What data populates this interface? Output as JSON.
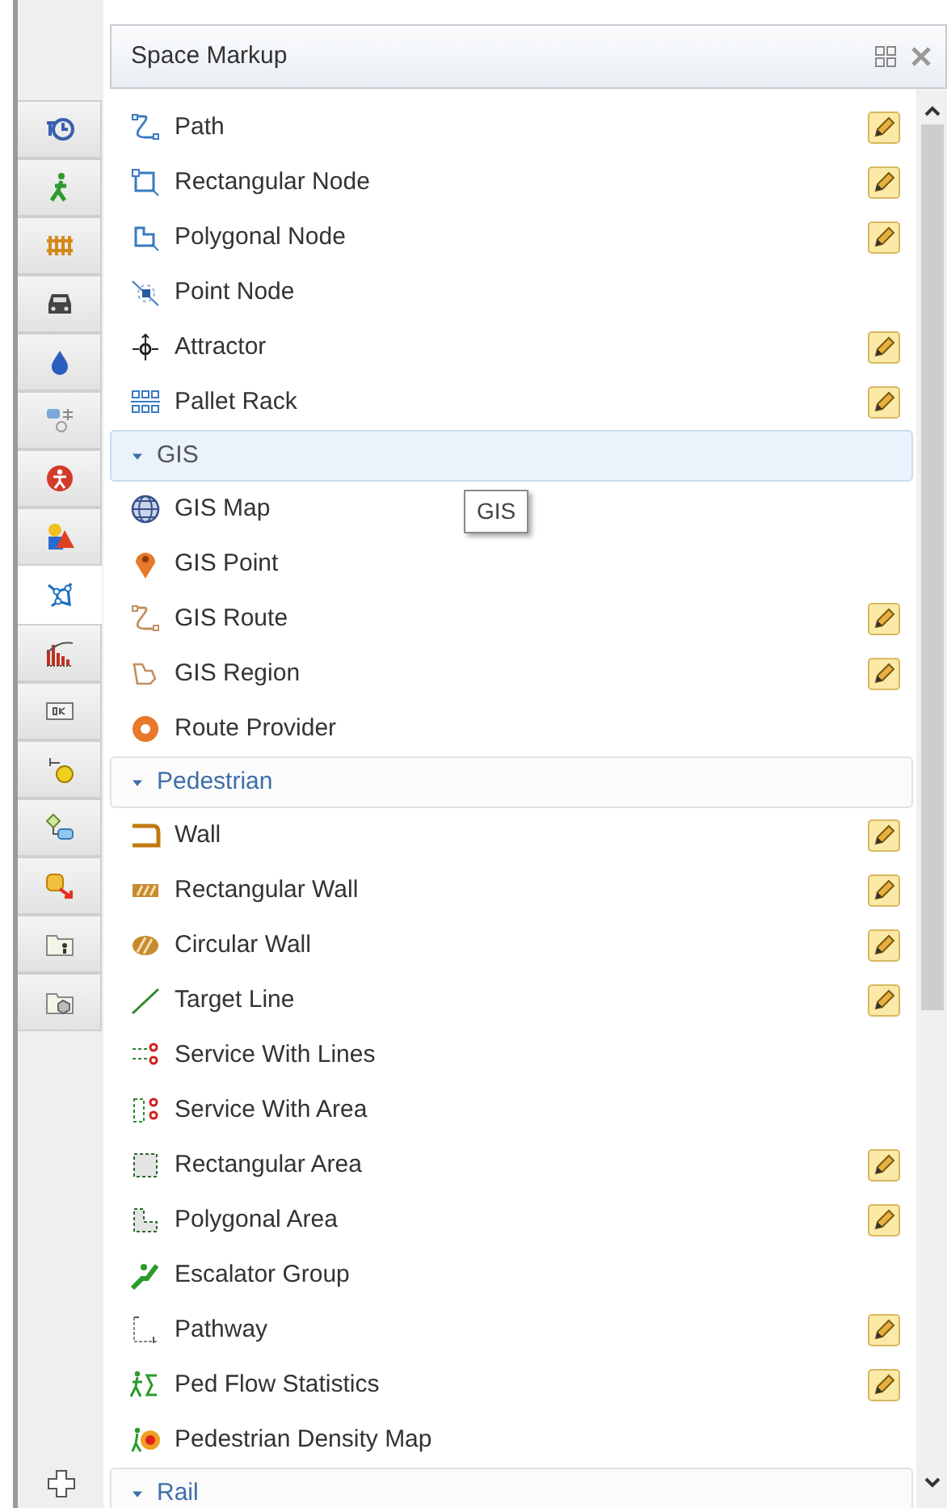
{
  "side_tabs": [
    {
      "selected": false
    },
    {
      "selected": false
    },
    {
      "selected": false
    },
    {
      "selected": false
    },
    {
      "selected": false
    },
    {
      "selected": false
    },
    {
      "selected": false
    },
    {
      "selected": false
    },
    {
      "selected": true
    },
    {
      "selected": false
    },
    {
      "selected": false
    },
    {
      "selected": false
    },
    {
      "selected": false
    },
    {
      "selected": false
    },
    {
      "selected": false
    },
    {
      "selected": false
    }
  ],
  "panel": {
    "title": "Space Markup"
  },
  "sections": [
    {
      "items": [
        {
          "name": "Path",
          "editable": true
        },
        {
          "name": "Rectangular Node",
          "editable": true
        },
        {
          "name": "Polygonal Node",
          "editable": true
        },
        {
          "name": "Point Node",
          "editable": false
        },
        {
          "name": "Attractor",
          "editable": true
        },
        {
          "name": "Pallet Rack",
          "editable": true
        }
      ]
    },
    {
      "title": "GIS",
      "expanded": true,
      "highlighted": true,
      "items": [
        {
          "name": "GIS Map",
          "editable": false
        },
        {
          "name": "GIS Point",
          "editable": false
        },
        {
          "name": "GIS Route",
          "editable": true
        },
        {
          "name": "GIS Region",
          "editable": true
        },
        {
          "name": "Route Provider",
          "editable": false
        }
      ]
    },
    {
      "title": "Pedestrian",
      "expanded": true,
      "highlighted": false,
      "items": [
        {
          "name": "Wall",
          "editable": true
        },
        {
          "name": "Rectangular Wall",
          "editable": true
        },
        {
          "name": "Circular Wall",
          "editable": true
        },
        {
          "name": "Target Line",
          "editable": true
        },
        {
          "name": "Service With Lines",
          "editable": false
        },
        {
          "name": "Service With Area",
          "editable": false
        },
        {
          "name": "Rectangular Area",
          "editable": true
        },
        {
          "name": "Polygonal Area",
          "editable": true
        },
        {
          "name": "Escalator Group",
          "editable": false
        },
        {
          "name": "Pathway",
          "editable": true
        },
        {
          "name": "Ped Flow Statistics",
          "editable": true
        },
        {
          "name": "Pedestrian Density Map",
          "editable": false
        }
      ]
    },
    {
      "title": "Rail",
      "expanded": true,
      "highlighted": false
    }
  ],
  "tooltip": {
    "text": "GIS"
  }
}
